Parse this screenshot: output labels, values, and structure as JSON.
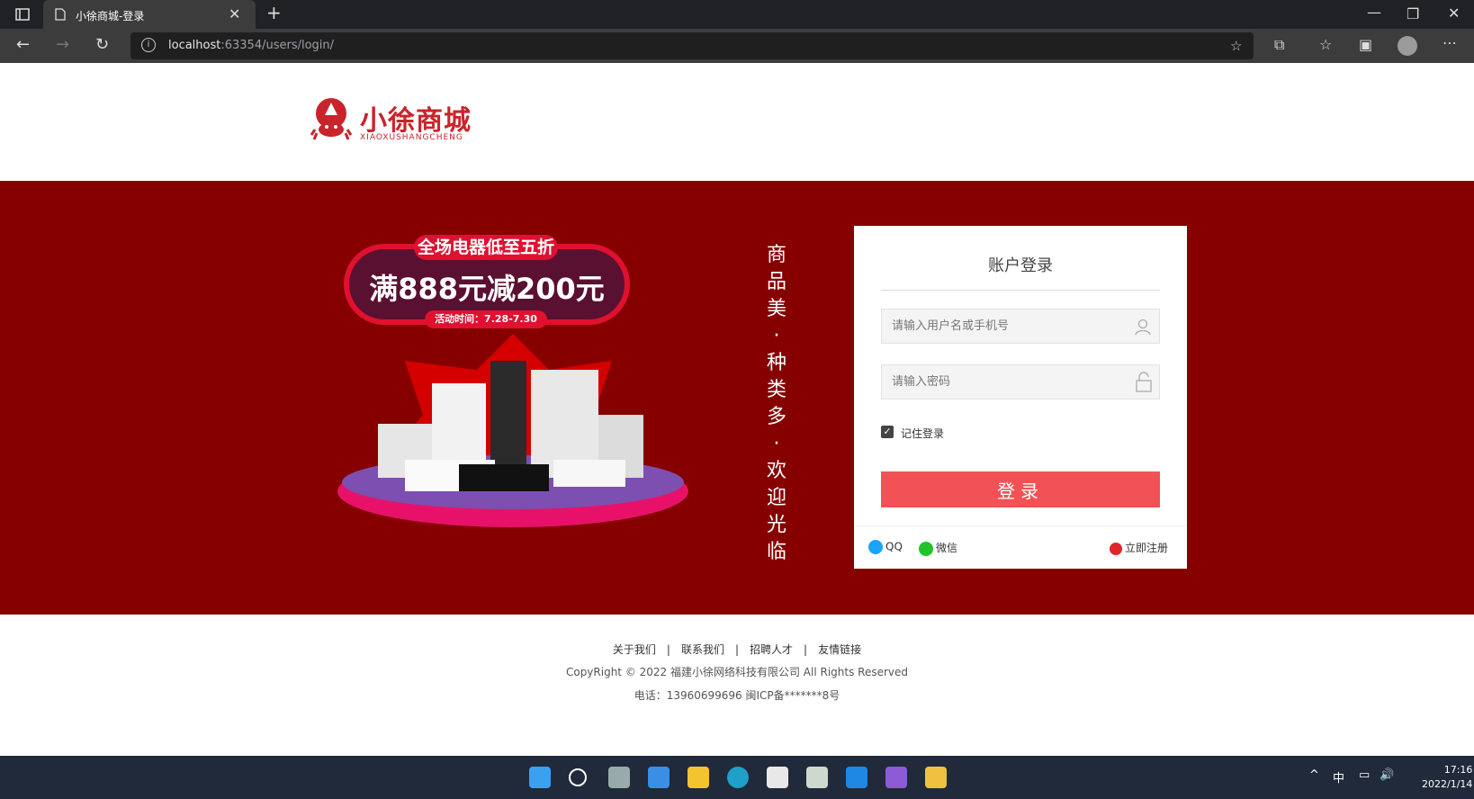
{
  "browser": {
    "tab_title": "小徐商城-登录",
    "url_host": "localhost",
    "url_rest": ":63354/users/login/"
  },
  "logo": {
    "name_cn": "小徐商城",
    "name_en": "XIAOXUSHANGCHENG"
  },
  "promo": {
    "tagline": "全场电器低至五折",
    "headline": "满888元减200元",
    "date": "活动时间：7.28-7.30"
  },
  "slogan": [
    "商",
    "品",
    "美",
    "·",
    "种",
    "类",
    "多",
    "·",
    "欢",
    "迎",
    "光",
    "临"
  ],
  "login": {
    "title": "账户登录",
    "username_placeholder": "请输入用户名或手机号",
    "password_placeholder": "请输入密码",
    "remember_label": "记住登录",
    "remember_checked": true,
    "submit_label": "登录",
    "qq_label": "QQ",
    "wechat_label": "微信",
    "register_label": "立即注册"
  },
  "footer": {
    "links": [
      "关于我们",
      "联系我们",
      "招聘人才",
      "友情链接"
    ],
    "separator": "|",
    "copyright": "CopyRight © 2022 福建小徐网络科技有限公司 All Rights Reserved",
    "phone": "电话：13960699696 闽ICP备*******8号"
  },
  "taskbar": {
    "time": "17:16",
    "date": "2022/1/14",
    "ime": "中"
  },
  "colors": {
    "banner_bg": "#860000",
    "accent": "#f25255",
    "brand": "#c9242b"
  }
}
